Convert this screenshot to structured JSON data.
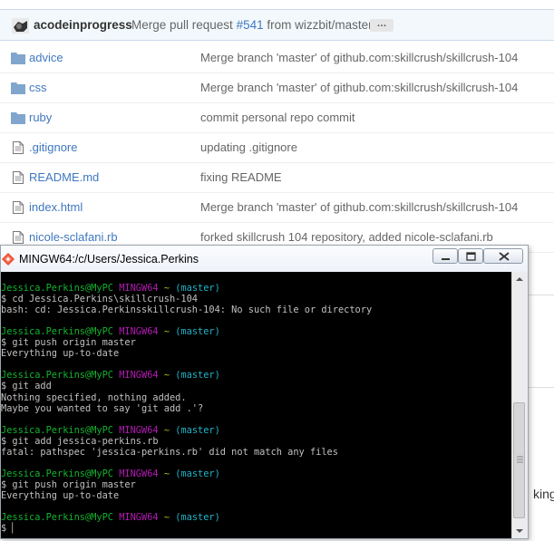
{
  "github": {
    "latest_commit": {
      "author": "acodeinprogress",
      "message_prefix": "Merge pull request ",
      "pr_link": "#541",
      "message_suffix": " from wizzbit/master",
      "ellipsis": "…"
    },
    "files": [
      {
        "name": "advice",
        "type": "folder",
        "message": "Merge branch 'master' of github.com:skillcrush/skillcrush-104"
      },
      {
        "name": "css",
        "type": "folder",
        "message": "Merge branch 'master' of github.com:skillcrush/skillcrush-104"
      },
      {
        "name": "ruby",
        "type": "folder",
        "message": "commit personal repo commit"
      },
      {
        "name": ".gitignore",
        "type": "file",
        "message": "updating .gitignore"
      },
      {
        "name": "README.md",
        "type": "file",
        "message": "fixing README"
      },
      {
        "name": "index.html",
        "type": "file",
        "message": "Merge branch 'master' of github.com:skillcrush/skillcrush-104"
      },
      {
        "name": "nicole-sclafani.rb",
        "type": "file",
        "message": "forked skillcrush 104 repository, added nicole-sclafani.rb"
      }
    ],
    "peek_text": "king"
  },
  "terminal": {
    "title": "MINGW64:/c/Users/Jessica.Perkins",
    "prompt": {
      "user": "Jessica.Perkins@MyPC",
      "env": "MINGW64",
      "path": "~",
      "branch": "(master)"
    },
    "blocks": [
      {
        "command": "$ cd Jessica.Perkins\\skillcrush-104",
        "output": [
          "bash: cd: Jessica.Perkinsskillcrush-104: No such file or directory"
        ]
      },
      {
        "command": "$ git push origin master",
        "output": [
          "Everything up-to-date"
        ]
      },
      {
        "command": "$ git add",
        "output": [
          "Nothing specified, nothing added.",
          "Maybe you wanted to say 'git add .'?"
        ]
      },
      {
        "command": "$ git add jessica-perkins.rb",
        "output": [
          "fatal: pathspec 'jessica-perkins.rb' did not match any files"
        ]
      },
      {
        "command": "$ git push origin master",
        "output": [
          "Everything up-to-date"
        ]
      }
    ],
    "final_prompt_line": "$ ",
    "colors": {
      "background": "#000000",
      "user": "#14b32e",
      "env": "#b41ab4",
      "path": "#b4b414",
      "branch": "#1eb4c8",
      "text": "#c0c0c0"
    }
  }
}
